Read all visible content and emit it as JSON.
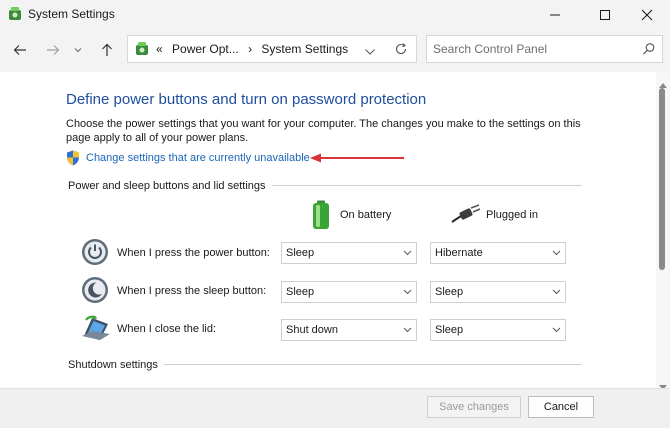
{
  "window": {
    "title": "System Settings",
    "controls": {
      "minimize": "minimize",
      "maximize": "maximize",
      "close": "close"
    }
  },
  "nav": {
    "breadcrumb_overflow": "«",
    "breadcrumbs": [
      "Power Opt...",
      "System Settings"
    ],
    "separator": "›"
  },
  "search": {
    "placeholder": "Search Control Panel"
  },
  "main": {
    "title": "Define power buttons and turn on password protection",
    "description": "Choose the power settings that you want for your computer. The changes you make to the settings on this page apply to all of your power plans.",
    "change_link": "Change settings that are currently unavailable",
    "power_section": "Power and sleep buttons and lid settings",
    "columns": {
      "battery": "On battery",
      "plugged": "Plugged in"
    },
    "rows": [
      {
        "label": "When I press the power button:",
        "battery": "Sleep",
        "plugged": "Hibernate",
        "icon": "power-button-icon"
      },
      {
        "label": "When I press the sleep button:",
        "battery": "Sleep",
        "plugged": "Sleep",
        "icon": "sleep-button-icon"
      },
      {
        "label": "When I close the lid:",
        "battery": "Shut down",
        "plugged": "Sleep",
        "icon": "laptop-lid-icon"
      }
    ],
    "shutdown_section": "Shutdown settings"
  },
  "footer": {
    "save": "Save changes",
    "cancel": "Cancel"
  },
  "colors": {
    "title_blue": "#1f4e9c",
    "link_blue": "#1a66b8",
    "arrow_red": "#d9343a"
  }
}
